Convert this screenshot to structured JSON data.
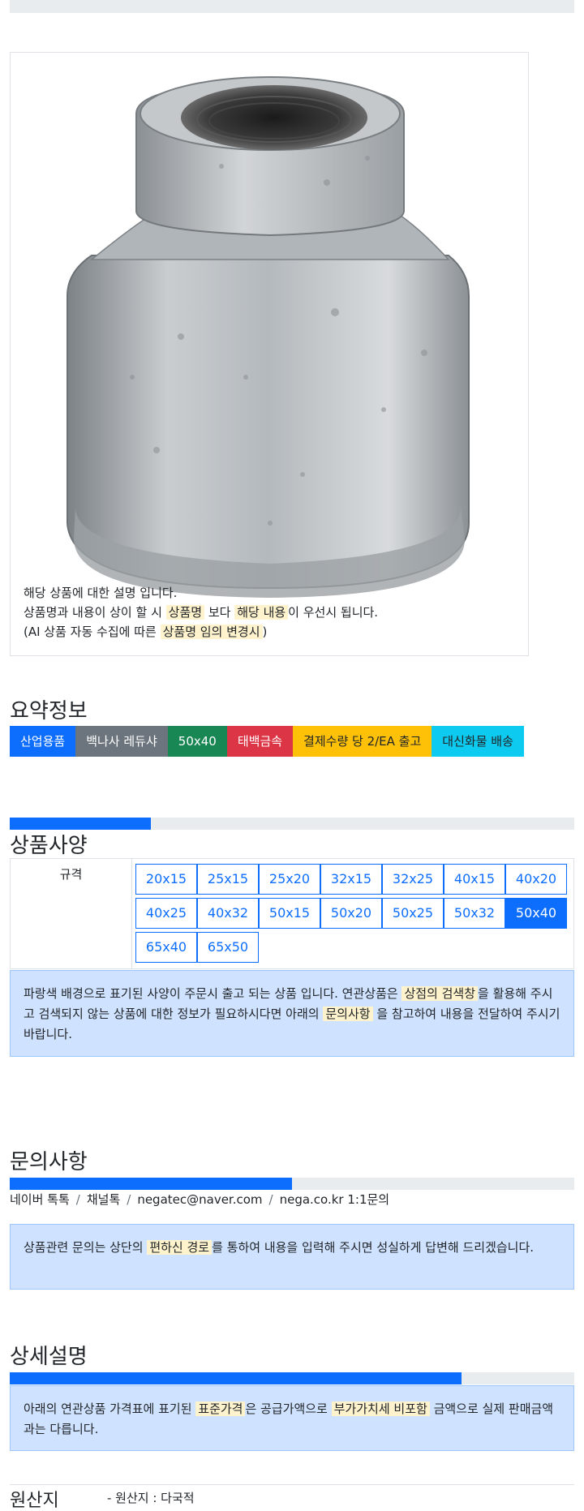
{
  "product": {
    "image_alt": "galvanized malleable iron reducing socket fitting",
    "desc_line1": "해당 상품에 대한 설명 입니다.",
    "desc_line2_a": "상품명과 내용이 상이 할 시 ",
    "desc_line2_hl1": "상품명",
    "desc_line2_b": " 보다 ",
    "desc_line2_hl2": "해당 내용",
    "desc_line2_c": "이 우선시 됩니다.",
    "desc_line3_a": "(AI 상품 자동 수집에 따른 ",
    "desc_line3_hl": "상품명 임의 변경시",
    "desc_line3_b": ")"
  },
  "summary": {
    "title": "요약정보",
    "badges": [
      {
        "label": "산업용품",
        "color": "#0d6efd",
        "text_color": "#ffffff"
      },
      {
        "label": "백나사 레듀샤",
        "color": "#6c757d",
        "text_color": "#ffffff"
      },
      {
        "label": "50x40",
        "color": "#198754",
        "text_color": "#ffffff"
      },
      {
        "label": "태백금속",
        "color": "#dc3545",
        "text_color": "#ffffff"
      },
      {
        "label": "결제수량 당 2/EA 출고",
        "color": "#ffc107",
        "text_color": "#212529"
      },
      {
        "label": "대신화물 배송",
        "color": "#0dcaf0",
        "text_color": "#212529"
      }
    ]
  },
  "specs": {
    "title": "상품사양",
    "progress_fraction": 0.25,
    "label": "규격",
    "options": [
      "20x15",
      "25x15",
      "25x20",
      "32x15",
      "32x25",
      "40x15",
      "40x20",
      "40x25",
      "40x32",
      "50x15",
      "50x20",
      "50x25",
      "50x32",
      "50x40",
      "65x40",
      "65x50"
    ],
    "selected": "50x40",
    "note_a": "파랑색 배경으로 표기된 사양이 주문시 출고 되는 상품 입니다. 연관상품은 ",
    "note_hl1": "상점의 검색창",
    "note_b": "을 활용해 주시고 검색되지 않는 상품에 대한 정보가 필요하시다면 아래의 ",
    "note_hl2": "문의사항",
    "note_c": " 을 참고하여 내용을 전달하여 주시기 바랍니다."
  },
  "inquiry": {
    "title": "문의사항",
    "progress_fraction": 0.5,
    "contacts": [
      "네이버 톡톡",
      "채널톡",
      "negatec@naver.com",
      "nega.co.kr 1:1문의"
    ],
    "note_a": "상품관련 문의는 상단의 ",
    "note_hl": "편하신 경로",
    "note_b": "를 통하여 내용을 입력해 주시면 성실하게 답변해 드리겠습니다."
  },
  "detail": {
    "title": "상세설명",
    "progress_fraction": 0.8,
    "note_a": "아래의 연관상품 가격표에 표기된 ",
    "note_hl1": "표준가격",
    "note_b": "은 공급가액으로 ",
    "note_hl2": "부가가치세 비포함",
    "note_c": " 금액으로 실제 판매금액과는 다릅니다."
  },
  "origin": {
    "title": "원산지",
    "value": "- 원산지 : 다국적"
  },
  "colors": {
    "primary": "#0d6efd",
    "highlight": "#fff3cd",
    "info_bg": "#cfe2ff"
  }
}
